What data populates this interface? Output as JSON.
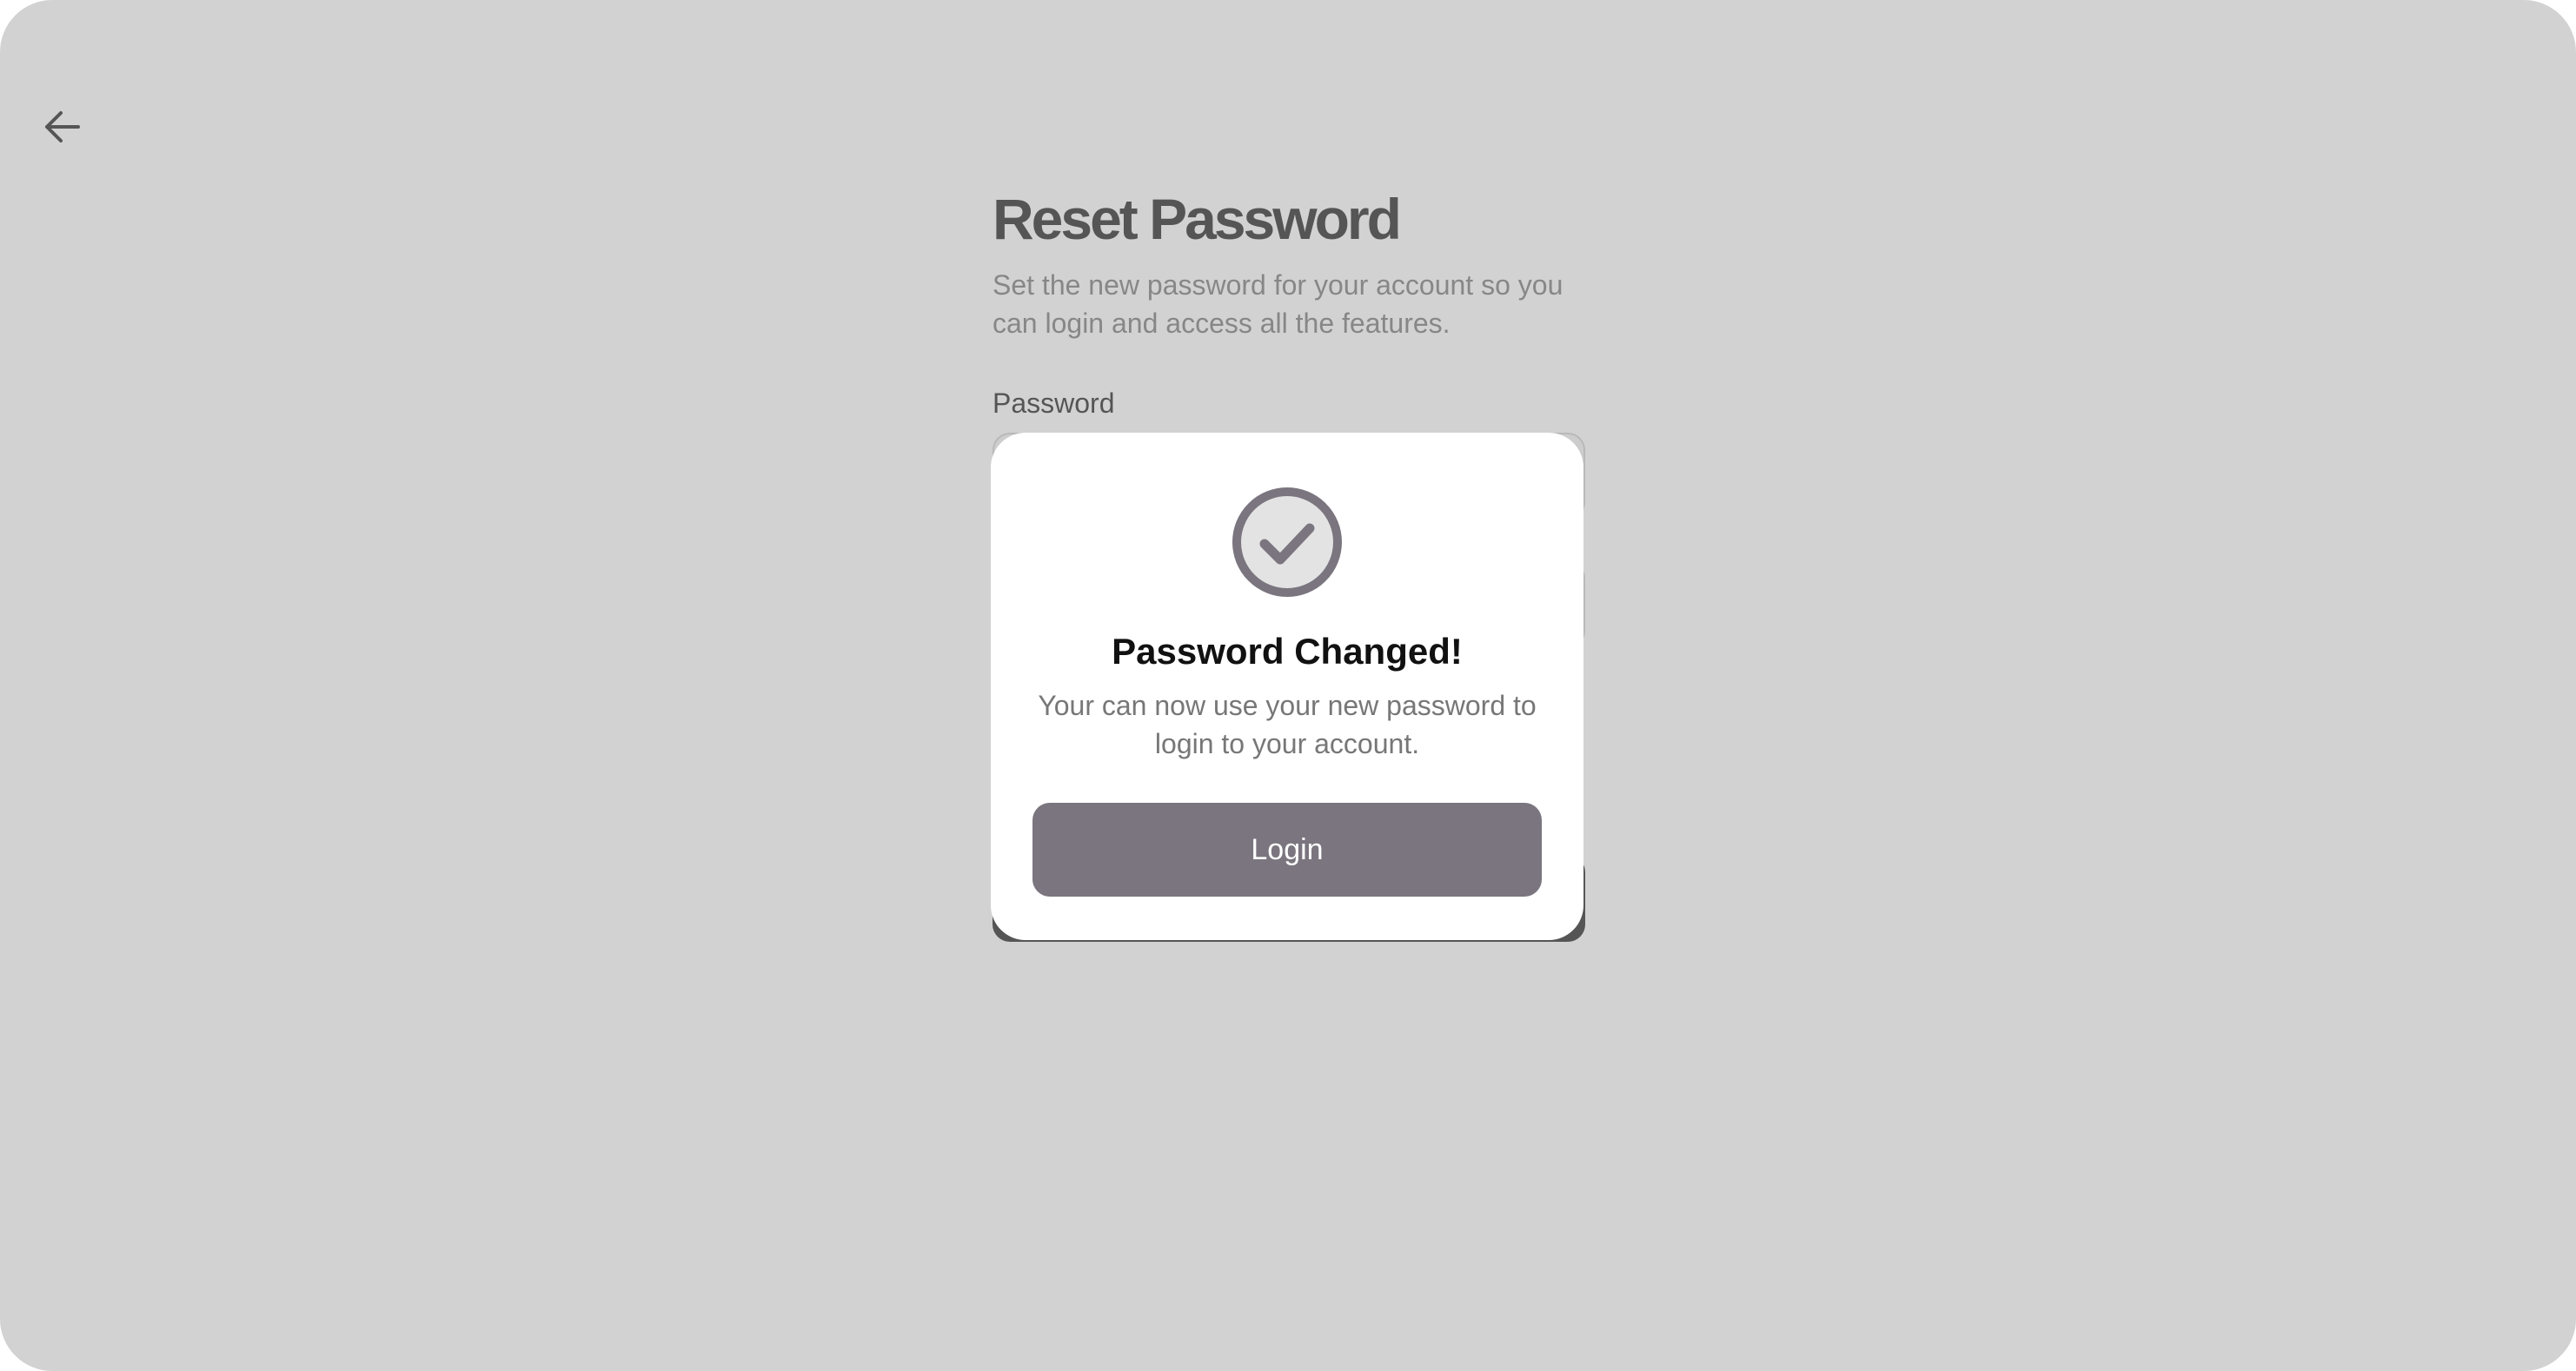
{
  "page": {
    "title": "Reset Password",
    "subtitle": "Set the new password for your account so you can login and access all the features.",
    "password_label": "Password"
  },
  "modal": {
    "icon": "check-circle-icon",
    "title": "Password Changed!",
    "message": "Your can now use your new password to login to your account.",
    "login_label": "Login"
  },
  "colors": {
    "overlay": "#d1d1d1",
    "primary_muted": "#7a757e",
    "text_dark": "#111111",
    "text_muted": "#777777"
  }
}
